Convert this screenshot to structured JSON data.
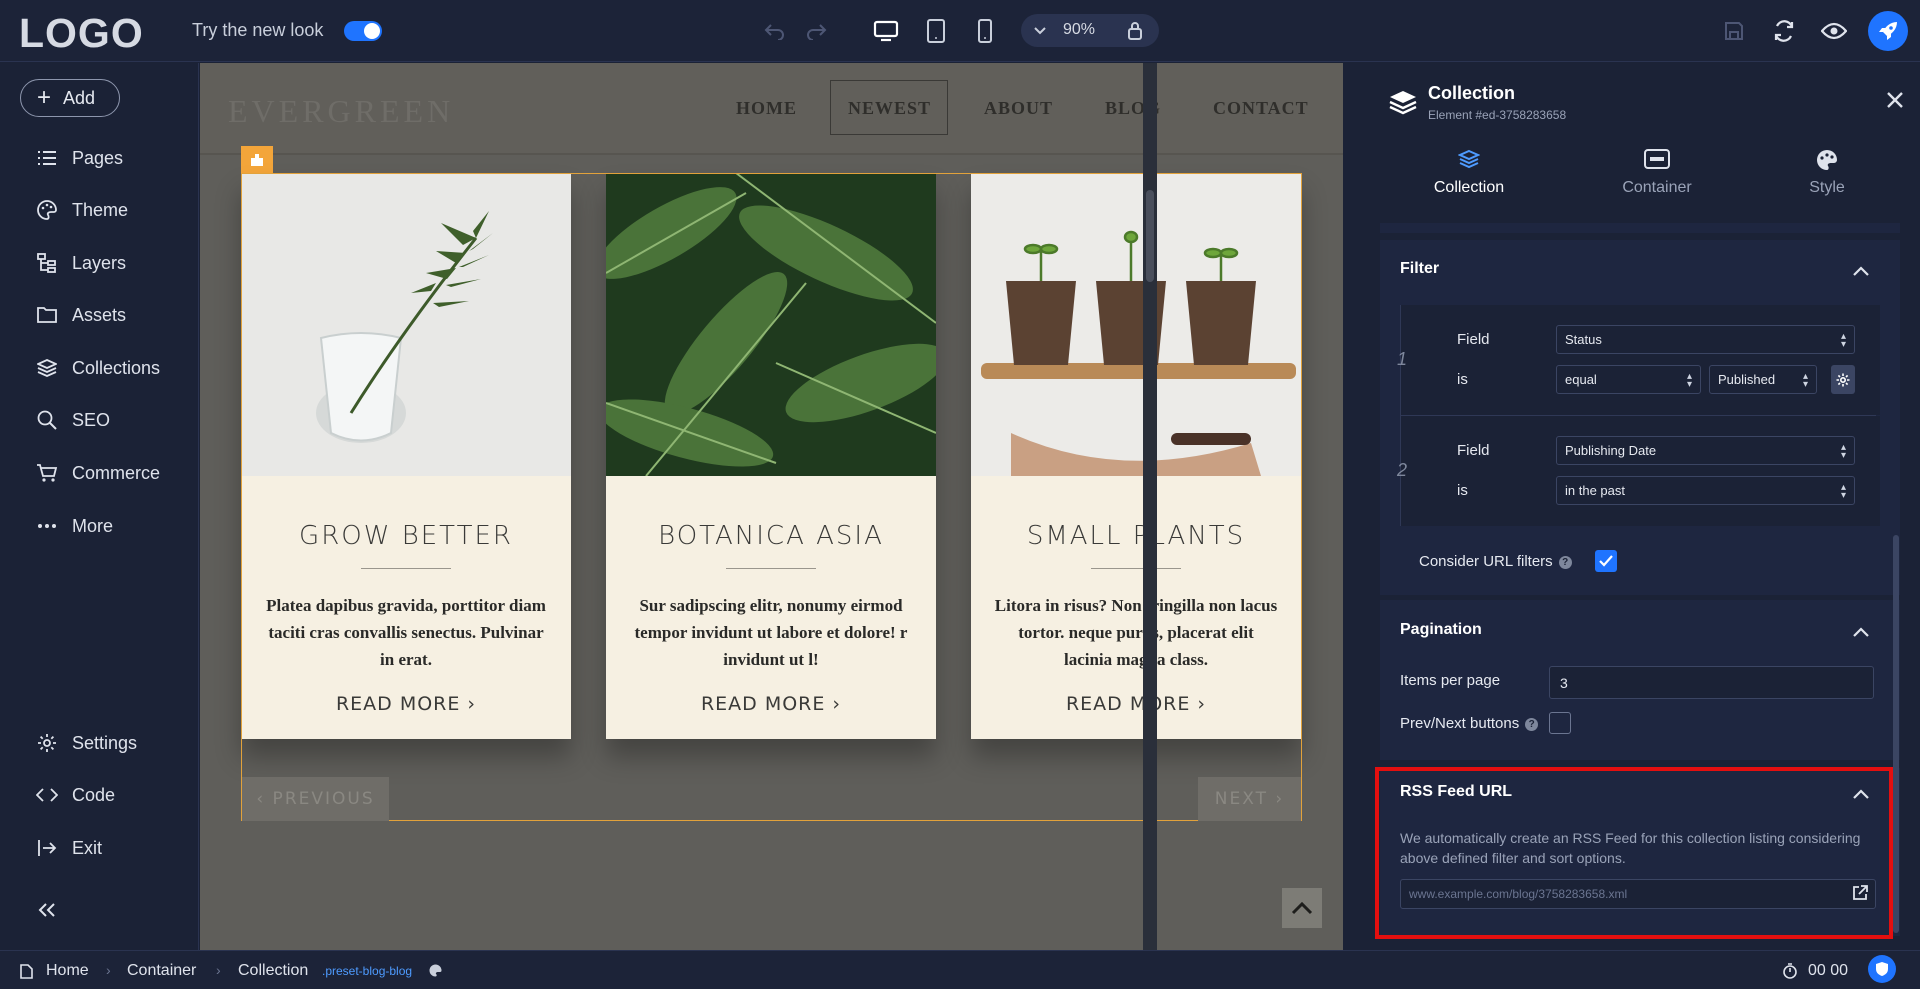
{
  "topbar": {
    "logo": "LOGO",
    "try_new_look": "Try the new look",
    "zoom": "90%"
  },
  "sidebar": {
    "add_label": "Add",
    "items": [
      {
        "label": "Pages",
        "icon": "list-icon"
      },
      {
        "label": "Theme",
        "icon": "palette-icon"
      },
      {
        "label": "Layers",
        "icon": "layers-tree-icon"
      },
      {
        "label": "Assets",
        "icon": "folder-icon"
      },
      {
        "label": "Collections",
        "icon": "stack-icon"
      },
      {
        "label": "SEO",
        "icon": "search-icon"
      },
      {
        "label": "Commerce",
        "icon": "cart-icon"
      },
      {
        "label": "More",
        "icon": "dots-icon"
      }
    ],
    "bottom_items": [
      {
        "label": "Settings",
        "icon": "gear-icon"
      },
      {
        "label": "Code",
        "icon": "code-icon"
      },
      {
        "label": "Exit",
        "icon": "exit-icon"
      }
    ]
  },
  "site": {
    "brand": "EVERGREEN",
    "nav": [
      "HOME",
      "NEWEST",
      "ABOUT",
      "BLOG",
      "CONTACT"
    ],
    "cards": [
      {
        "title": "GROW BETTER",
        "body": "Platea dapibus gravida, porttitor diam taciti cras convallis senectus. Pulvinar in erat.",
        "more": "READ MORE ›"
      },
      {
        "title": "BOTANICA ASIA",
        "body": "Sur sadipscing elitr, nonumy eirmod tempor invidunt ut labore et dolore! r invidunt ut l!",
        "more": "READ MORE ›"
      },
      {
        "title": "SMALL PLANTS",
        "body": "Litora in risus? Non fringilla non lacus tortor. neque purus, placerat elit lacinia magna class.",
        "more": "READ MORE ›"
      }
    ],
    "prev": "‹ PREVIOUS",
    "next": "NEXT ›"
  },
  "panel": {
    "title": "Collection",
    "subtitle": "Element #ed-3758283658",
    "tabs": [
      "Collection",
      "Container",
      "Style"
    ],
    "filter": {
      "title": "Filter",
      "rules": [
        {
          "num": "1",
          "field_label": "Field",
          "field": "Status",
          "op_label": "is",
          "op": "equal",
          "value": "Published"
        },
        {
          "num": "2",
          "field_label": "Field",
          "field": "Publishing Date",
          "op_label": "is",
          "op": "in the past"
        }
      ],
      "consider_url": "Consider URL filters",
      "consider_url_checked": true
    },
    "pagination": {
      "title": "Pagination",
      "items_label": "Items per page",
      "items_value": "3",
      "prevnext_label": "Prev/Next buttons",
      "prevnext_checked": false
    },
    "rss": {
      "title": "RSS Feed URL",
      "desc": "We automatically create an RSS Feed for this collection listing considering above defined filter and sort options.",
      "url": "www.example.com/blog/3758283658.xml"
    }
  },
  "bottombar": {
    "crumbs": [
      "Home",
      "Container",
      "Collection"
    ],
    "class_name": ".preset-blog-blog",
    "time": "00 00"
  },
  "colors": {
    "accent": "#1f74ff",
    "highlight": "#e40f0f",
    "frame": "#f3a53a"
  }
}
